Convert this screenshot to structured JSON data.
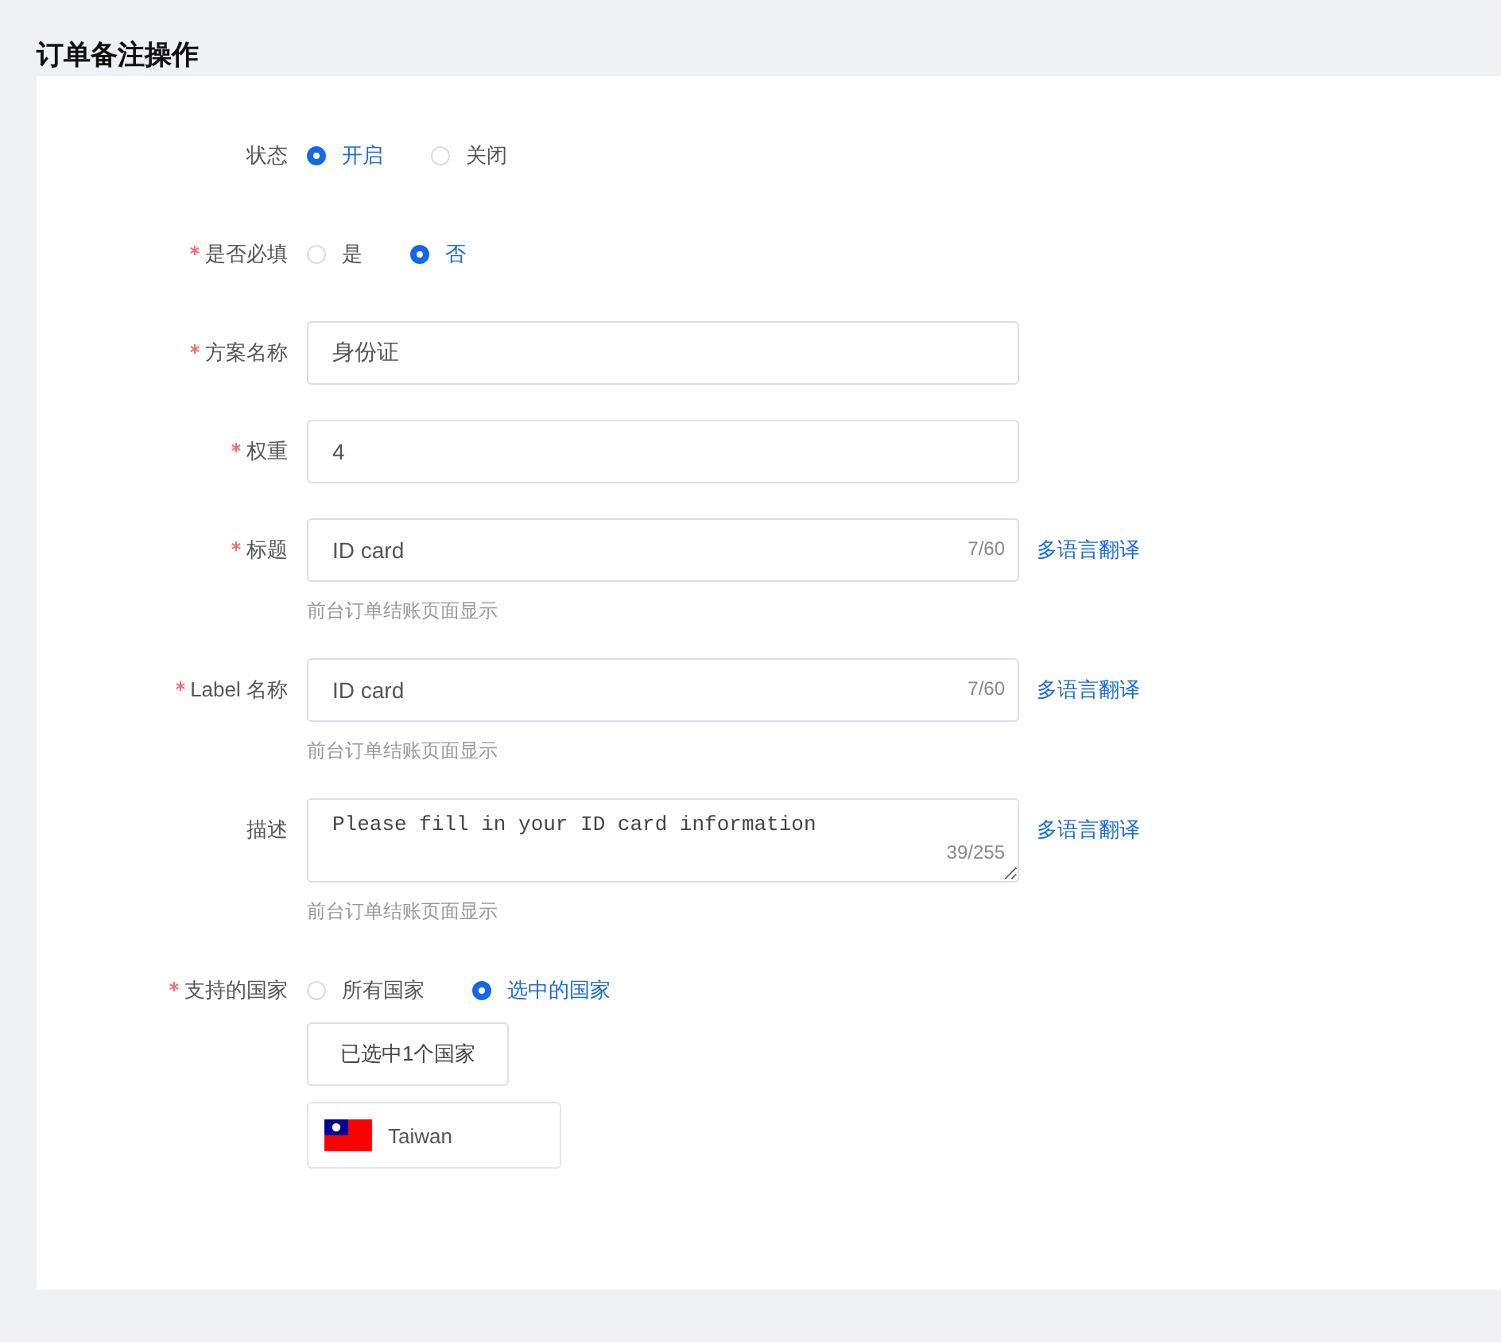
{
  "title": "订单备注操作",
  "fields": [
    {
      "kind": "radio",
      "label": "状态",
      "required": false,
      "options": [
        {
          "label": "开启",
          "selected": true
        },
        {
          "label": "关闭",
          "selected": false
        }
      ]
    },
    {
      "kind": "radio",
      "label": "是否必填",
      "required": true,
      "options": [
        {
          "label": "是",
          "selected": false
        },
        {
          "label": "否",
          "selected": true
        }
      ]
    },
    {
      "kind": "input",
      "label": "方案名称",
      "required": true,
      "value": "身份证"
    },
    {
      "kind": "input",
      "label": "权重",
      "required": true,
      "value": "4"
    },
    {
      "kind": "input",
      "label": "标题",
      "required": true,
      "value": "ID card",
      "count": "7/60",
      "link": "多语言翻译",
      "hint": "前台订单结账页面显示"
    },
    {
      "kind": "input",
      "label": "Label 名称",
      "required": true,
      "value": "ID card",
      "count": "7/60",
      "link": "多语言翻译",
      "hint": "前台订单结账页面显示"
    },
    {
      "kind": "textarea",
      "label": "描述",
      "required": false,
      "value": "Please fill in your ID card information",
      "count": "39/255",
      "link": "多语言翻译",
      "hint": "前台订单结账页面显示"
    },
    {
      "kind": "countries",
      "label": "支持的国家",
      "required": true,
      "options": [
        {
          "label": "所有国家",
          "selected": false
        },
        {
          "label": "选中的国家",
          "selected": true
        }
      ],
      "button": "已选中1个国家",
      "countries": [
        {
          "name": "Taiwan"
        }
      ]
    }
  ]
}
